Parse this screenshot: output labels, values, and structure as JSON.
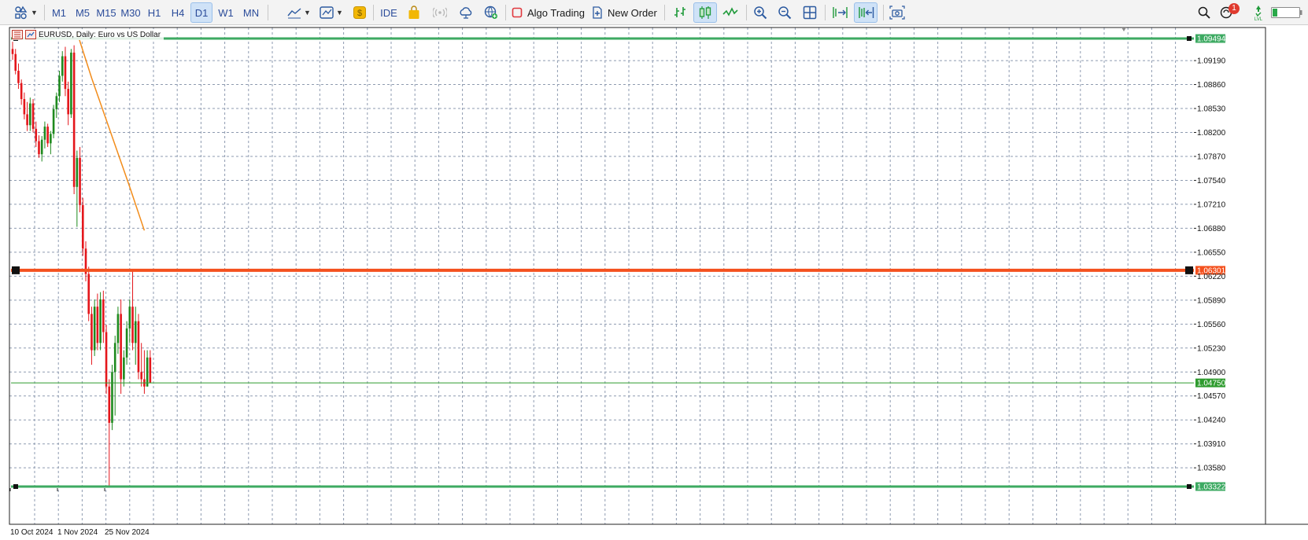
{
  "toolbar": {
    "timeframes": [
      "M1",
      "M5",
      "M15",
      "M30",
      "H1",
      "H4",
      "D1",
      "W1",
      "MN"
    ],
    "active_timeframe": "D1",
    "ide_label": "IDE",
    "algo_trading_label": "Algo Trading",
    "new_order_label": "New Order",
    "notification_count": "1",
    "icons": [
      "objects-icon",
      "indicators-icon",
      "templates-icon",
      "market-icon",
      "shopping-bag-icon",
      "signals-icon",
      "cloud-icon",
      "vps-icon",
      "stop-icon",
      "new-order-icon",
      "bar-chart-icon",
      "candlestick-icon",
      "line-chart-icon",
      "zoom-in-icon",
      "zoom-out-icon",
      "grid-icon",
      "autoscroll-icon",
      "chart-shift-icon",
      "screenshot-icon",
      "search-icon",
      "notifications-icon",
      "depth-icon",
      "battery-icon"
    ]
  },
  "chart": {
    "title": "EURUSD, Daily: Euro vs US Dollar",
    "colors": {
      "bull": "#1e8a1e",
      "bear": "#e4161b",
      "grid": "#8e9bb0",
      "resistance": "#3daa62",
      "support": "#3daa62",
      "key_level": "#f4511e",
      "bid": "#2e9b2e",
      "ma": "#f28c1a"
    }
  },
  "chart_data": {
    "type": "candlestick",
    "symbol": "EURUSD",
    "timeframe": "Daily",
    "y_ticks": [
      "1.09190",
      "1.08860",
      "1.08530",
      "1.08200",
      "1.07870",
      "1.07540",
      "1.07210",
      "1.06880",
      "1.06550",
      "1.06220",
      "1.05890",
      "1.05560",
      "1.05230",
      "1.04900",
      "1.04570",
      "1.04240",
      "1.03910",
      "1.03580"
    ],
    "x_ticks": [
      "10 Oct 2024",
      "1 Nov 2024",
      "25 Nov 2024"
    ],
    "ylim": [
      1.0325,
      1.0955
    ],
    "horizontal_lines": [
      {
        "name": "upper-level",
        "price": "1.09494",
        "color": "#3daa62"
      },
      {
        "name": "key-level",
        "price": "1.06301",
        "color": "#f4511e"
      },
      {
        "name": "bid",
        "price": "1.04750",
        "color": "#2e9b2e"
      },
      {
        "name": "lower-level",
        "price": "1.03322",
        "color": "#3daa62"
      }
    ],
    "moving_average": [
      [
        22,
        1.0958
      ],
      [
        27,
        1.0895
      ],
      [
        40,
        1.0745
      ],
      [
        45,
        1.0685
      ]
    ],
    "candles": [
      {
        "o": 1.0935,
        "h": 1.0945,
        "l": 1.092,
        "c": 1.0928
      },
      {
        "o": 1.0928,
        "h": 1.0935,
        "l": 1.09,
        "c": 1.0905
      },
      {
        "o": 1.0905,
        "h": 1.0915,
        "l": 1.088,
        "c": 1.0888
      },
      {
        "o": 1.0888,
        "h": 1.0893,
        "l": 1.0858,
        "c": 1.0866
      },
      {
        "o": 1.0866,
        "h": 1.0875,
        "l": 1.0838,
        "c": 1.0845
      },
      {
        "o": 1.0845,
        "h": 1.0862,
        "l": 1.0822,
        "c": 1.083
      },
      {
        "o": 1.083,
        "h": 1.0868,
        "l": 1.0822,
        "c": 1.086
      },
      {
        "o": 1.086,
        "h": 1.0866,
        "l": 1.082,
        "c": 1.0825
      },
      {
        "o": 1.0825,
        "h": 1.0835,
        "l": 1.08,
        "c": 1.0808
      },
      {
        "o": 1.0808,
        "h": 1.0816,
        "l": 1.0785,
        "c": 1.079
      },
      {
        "o": 1.079,
        "h": 1.0815,
        "l": 1.078,
        "c": 1.081
      },
      {
        "o": 1.081,
        "h": 1.0835,
        "l": 1.0798,
        "c": 1.0828
      },
      {
        "o": 1.0828,
        "h": 1.0832,
        "l": 1.08,
        "c": 1.0805
      },
      {
        "o": 1.0805,
        "h": 1.0822,
        "l": 1.079,
        "c": 1.0818
      },
      {
        "o": 1.0818,
        "h": 1.0858,
        "l": 1.0812,
        "c": 1.0852
      },
      {
        "o": 1.0852,
        "h": 1.0875,
        "l": 1.084,
        "c": 1.087
      },
      {
        "o": 1.087,
        "h": 1.0905,
        "l": 1.0862,
        "c": 1.0898
      },
      {
        "o": 1.0898,
        "h": 1.0932,
        "l": 1.089,
        "c": 1.0925
      },
      {
        "o": 1.0925,
        "h": 1.0938,
        "l": 1.087,
        "c": 1.088
      },
      {
        "o": 1.088,
        "h": 1.089,
        "l": 1.083,
        "c": 1.0845
      },
      {
        "o": 1.0845,
        "h": 1.0935,
        "l": 1.084,
        "c": 1.093
      },
      {
        "o": 1.093,
        "h": 1.094,
        "l": 1.0735,
        "c": 1.0745
      },
      {
        "o": 1.0745,
        "h": 1.0795,
        "l": 1.069,
        "c": 1.0785
      },
      {
        "o": 1.0785,
        "h": 1.08,
        "l": 1.071,
        "c": 1.072
      },
      {
        "o": 1.072,
        "h": 1.073,
        "l": 1.065,
        "c": 1.066
      },
      {
        "o": 1.066,
        "h": 1.067,
        "l": 1.0615,
        "c": 1.0625
      },
      {
        "o": 1.0625,
        "h": 1.0635,
        "l": 1.056,
        "c": 1.057
      },
      {
        "o": 1.057,
        "h": 1.058,
        "l": 1.05,
        "c": 1.052
      },
      {
        "o": 1.052,
        "h": 1.059,
        "l": 1.0512,
        "c": 1.058
      },
      {
        "o": 1.058,
        "h": 1.0598,
        "l": 1.052,
        "c": 1.053
      },
      {
        "o": 1.053,
        "h": 1.06,
        "l": 1.052,
        "c": 1.059
      },
      {
        "o": 1.059,
        "h": 1.0602,
        "l": 1.053,
        "c": 1.0545
      },
      {
        "o": 1.0545,
        "h": 1.0555,
        "l": 1.046,
        "c": 1.047
      },
      {
        "o": 1.047,
        "h": 1.048,
        "l": 1.0333,
        "c": 1.042
      },
      {
        "o": 1.042,
        "h": 1.05,
        "l": 1.041,
        "c": 1.049
      },
      {
        "o": 1.049,
        "h": 1.054,
        "l": 1.043,
        "c": 1.053
      },
      {
        "o": 1.053,
        "h": 1.058,
        "l": 1.0515,
        "c": 1.057
      },
      {
        "o": 1.057,
        "h": 1.059,
        "l": 1.046,
        "c": 1.048
      },
      {
        "o": 1.048,
        "h": 1.052,
        "l": 1.047,
        "c": 1.051
      },
      {
        "o": 1.051,
        "h": 1.056,
        "l": 1.05,
        "c": 1.055
      },
      {
        "o": 1.055,
        "h": 1.059,
        "l": 1.053,
        "c": 1.058
      },
      {
        "o": 1.058,
        "h": 1.0632,
        "l": 1.052,
        "c": 1.053
      },
      {
        "o": 1.053,
        "h": 1.058,
        "l": 1.05,
        "c": 1.056
      },
      {
        "o": 1.056,
        "h": 1.057,
        "l": 1.048,
        "c": 1.049
      },
      {
        "o": 1.049,
        "h": 1.053,
        "l": 1.047,
        "c": 1.048
      },
      {
        "o": 1.048,
        "h": 1.052,
        "l": 1.046,
        "c": 1.047
      },
      {
        "o": 1.047,
        "h": 1.052,
        "l": 1.047,
        "c": 1.051
      },
      {
        "o": 1.051,
        "h": 1.052,
        "l": 1.048,
        "c": 1.0475
      }
    ]
  }
}
